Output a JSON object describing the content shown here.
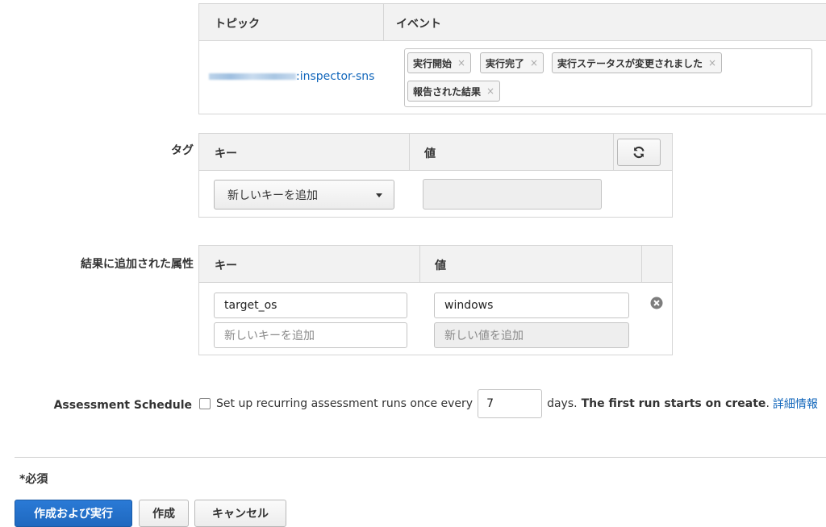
{
  "sns": {
    "headers": {
      "topic": "トピック",
      "event": "イベント"
    },
    "topic_suffix": ":inspector-sns",
    "events": [
      {
        "label": "実行開始"
      },
      {
        "label": "実行完了"
      },
      {
        "label": "実行ステータスが変更されました"
      },
      {
        "label": "報告された結果"
      }
    ],
    "chip_remove": "×"
  },
  "tags": {
    "label": "タグ",
    "key_header": "キー",
    "value_header": "値",
    "key_select": "新しいキーを追加",
    "refresh_icon": "refresh-icon"
  },
  "attributes": {
    "label": "結果に追加された属性",
    "key_header": "キー",
    "value_header": "値",
    "rows": [
      {
        "key": "target_os",
        "value": "windows"
      }
    ],
    "new_key_placeholder": "新しいキーを追加",
    "new_value_placeholder": "新しい値を追加"
  },
  "schedule": {
    "label": "Assessment Schedule",
    "checkbox_text": "Set up recurring assessment runs once every",
    "days_value": "7",
    "days_suffix": "days.",
    "first_run": "The first run starts on create",
    "period": ".",
    "more_info": "詳細情報"
  },
  "footer": {
    "required_note": "*必須",
    "create_and_run": "作成および実行",
    "create": "作成",
    "cancel": "キャンセル"
  },
  "colors": {
    "primary": "#2272cc",
    "link": "#1166bb",
    "border": "#d5d5d5"
  }
}
